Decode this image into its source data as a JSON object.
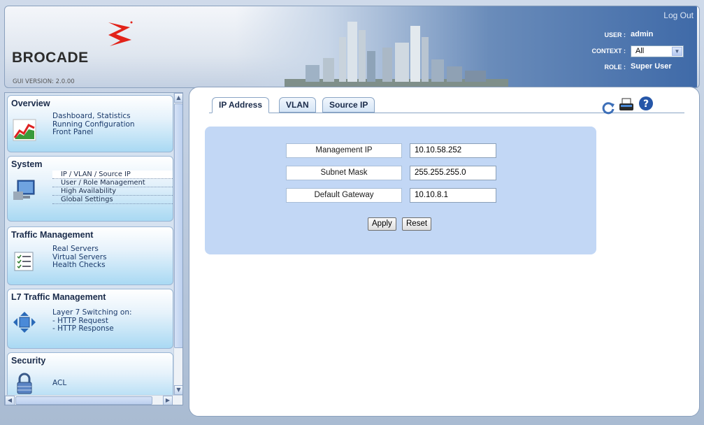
{
  "header": {
    "brand": "BROCADE",
    "gui_version": "GUI VERSION: 2.0.00",
    "logout": "Log Out",
    "user_label": "USER :",
    "user_value": "admin",
    "context_label": "CONTEXT :",
    "context_value": "All",
    "role_label": "ROLE :",
    "role_value": "Super User"
  },
  "sidebar": {
    "overview": {
      "title": "Overview",
      "links": [
        "Dashboard, Statistics",
        "Running Configuration",
        "Front Panel"
      ]
    },
    "system": {
      "title": "System",
      "items": [
        "IP / VLAN / Source IP",
        "User / Role Management",
        "High Availability",
        "Global Settings"
      ],
      "active_index": 0
    },
    "traffic": {
      "title": "Traffic Management",
      "links": [
        "Real Servers",
        "Virtual Servers",
        "Health Checks"
      ]
    },
    "l7": {
      "title": "L7 Traffic Management",
      "links": [
        "Layer 7 Switching on:",
        "- HTTP Request",
        "- HTTP Response"
      ]
    },
    "security": {
      "title": "Security",
      "links": [
        "ACL"
      ]
    }
  },
  "main": {
    "tabs": [
      {
        "label": "IP Address",
        "active": true
      },
      {
        "label": "VLAN",
        "active": false
      },
      {
        "label": "Source IP",
        "active": false
      }
    ],
    "form": {
      "fields": [
        {
          "label": "Management IP",
          "value": "10.10.58.252"
        },
        {
          "label": "Subnet Mask",
          "value": "255.255.255.0"
        },
        {
          "label": "Default Gateway",
          "value": "10.10.8.1"
        }
      ],
      "apply_label": "Apply",
      "reset_label": "Reset"
    },
    "toolbar_icons": [
      "refresh-icon",
      "print-icon",
      "help-icon"
    ]
  },
  "colors": {
    "brand_red": "#e2231a",
    "form_bg": "#c2d7f5",
    "panel_gradient_end": "#a9d9f3"
  }
}
